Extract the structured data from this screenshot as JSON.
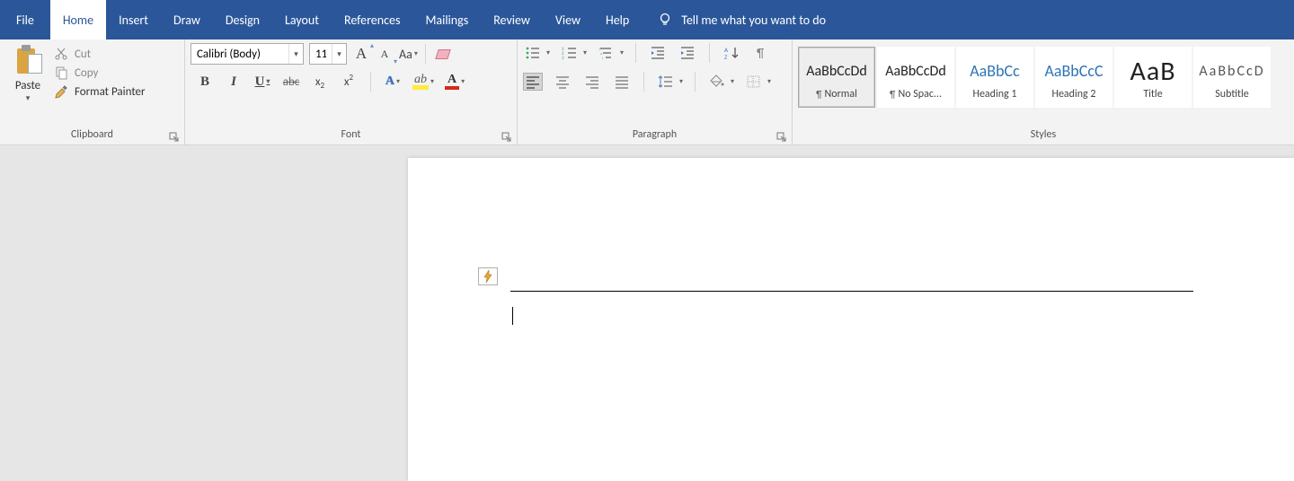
{
  "tabs": {
    "file": "File",
    "home": "Home",
    "insert": "Insert",
    "draw": "Draw",
    "design": "Design",
    "layout": "Layout",
    "references": "References",
    "mailings": "Mailings",
    "review": "Review",
    "view": "View",
    "help": "Help",
    "tellme": "Tell me what you want to do"
  },
  "clipboard": {
    "paste": "Paste",
    "cut": "Cut",
    "copy": "Copy",
    "format_painter": "Format Painter",
    "group": "Clipboard"
  },
  "font": {
    "name": "Calibri (Body)",
    "size": "11",
    "case_label": "Aa",
    "group": "Font"
  },
  "paragraph": {
    "group": "Paragraph"
  },
  "styles": {
    "group": "Styles",
    "items": [
      {
        "preview": "AaBbCcDd",
        "name": "Normal",
        "pilcrow": true,
        "cls": "prev-body",
        "sel": true
      },
      {
        "preview": "AaBbCcDd",
        "name": "No Spac...",
        "pilcrow": true,
        "cls": "prev-body",
        "sel": false
      },
      {
        "preview": "AaBbCc",
        "name": "Heading 1",
        "pilcrow": false,
        "cls": "prev-head",
        "sel": false
      },
      {
        "preview": "AaBbCcC",
        "name": "Heading 2",
        "pilcrow": false,
        "cls": "prev-head",
        "sel": false
      },
      {
        "preview": "AaB",
        "name": "Title",
        "pilcrow": false,
        "cls": "prev-title",
        "sel": false
      },
      {
        "preview": "AaBbCcD",
        "name": "Subtitle",
        "pilcrow": false,
        "cls": "prev-sub",
        "sel": false
      }
    ]
  }
}
